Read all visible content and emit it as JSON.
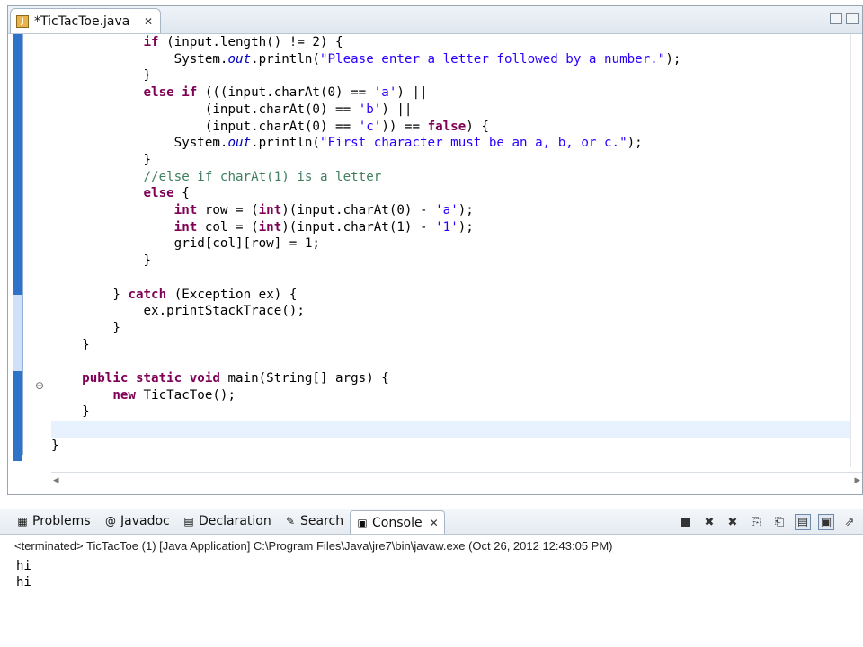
{
  "editor": {
    "tab_label": "*TicTacToe.java",
    "tab_close": "✕",
    "code_lines": [
      {
        "kind": "plain",
        "indent": "            ",
        "parts": [
          [
            "kw",
            "if"
          ],
          [
            "p",
            " (input.length() != 2) {"
          ]
        ]
      },
      {
        "kind": "plain",
        "indent": "                ",
        "parts": [
          [
            "p",
            "System."
          ],
          [
            "it",
            "out"
          ],
          [
            "p",
            ".println("
          ],
          [
            "str",
            "\"Please enter a letter followed by a number.\""
          ],
          [
            "p",
            ");"
          ]
        ]
      },
      {
        "kind": "plain",
        "indent": "            ",
        "parts": [
          [
            "p",
            "}"
          ]
        ]
      },
      {
        "kind": "plain",
        "indent": "            ",
        "parts": [
          [
            "kw",
            "else if"
          ],
          [
            "p",
            " ((("
          ],
          [
            "p",
            "input.charAt(0) == "
          ],
          [
            "str",
            "'a'"
          ],
          [
            "p",
            ") ||"
          ]
        ]
      },
      {
        "kind": "plain",
        "indent": "                    ",
        "parts": [
          [
            "p",
            "(input.charAt(0) == "
          ],
          [
            "str",
            "'b'"
          ],
          [
            "p",
            ") ||"
          ]
        ]
      },
      {
        "kind": "plain",
        "indent": "                    ",
        "parts": [
          [
            "p",
            "(input.charAt(0) == "
          ],
          [
            "str",
            "'c'"
          ],
          [
            "p",
            ")) == "
          ],
          [
            "kw",
            "false"
          ],
          [
            "p",
            ") {"
          ]
        ]
      },
      {
        "kind": "plain",
        "indent": "                ",
        "parts": [
          [
            "p",
            "System."
          ],
          [
            "it",
            "out"
          ],
          [
            "p",
            ".println("
          ],
          [
            "str",
            "\"First character must be an a, b, or c.\""
          ],
          [
            "p",
            ");"
          ]
        ]
      },
      {
        "kind": "plain",
        "indent": "            ",
        "parts": [
          [
            "p",
            "}"
          ]
        ]
      },
      {
        "kind": "plain",
        "indent": "            ",
        "parts": [
          [
            "cm",
            "//else if charAt(1) is a letter"
          ]
        ]
      },
      {
        "kind": "plain",
        "indent": "            ",
        "parts": [
          [
            "kw",
            "else"
          ],
          [
            "p",
            " {"
          ]
        ]
      },
      {
        "kind": "plain",
        "indent": "                ",
        "parts": [
          [
            "kw",
            "int"
          ],
          [
            "p",
            " row = ("
          ],
          [
            "kw",
            "int"
          ],
          [
            "p",
            ")(input.charAt(0) - "
          ],
          [
            "str",
            "'a'"
          ],
          [
            "p",
            ");"
          ]
        ]
      },
      {
        "kind": "plain",
        "indent": "                ",
        "parts": [
          [
            "kw",
            "int"
          ],
          [
            "p",
            " col = ("
          ],
          [
            "kw",
            "int"
          ],
          [
            "p",
            ")(input.charAt(1) - "
          ],
          [
            "str",
            "'1'"
          ],
          [
            "p",
            ");"
          ]
        ]
      },
      {
        "kind": "plain",
        "indent": "                ",
        "parts": [
          [
            "p",
            "grid[col][row] = 1;"
          ]
        ]
      },
      {
        "kind": "plain",
        "indent": "            ",
        "parts": [
          [
            "p",
            "}"
          ]
        ]
      },
      {
        "kind": "plain",
        "indent": "",
        "parts": []
      },
      {
        "kind": "plain",
        "indent": "        ",
        "parts": [
          [
            "p",
            "} "
          ],
          [
            "kw",
            "catch"
          ],
          [
            "p",
            " (Exception ex) {"
          ]
        ]
      },
      {
        "kind": "plain",
        "indent": "            ",
        "parts": [
          [
            "p",
            "ex.printStackTrace();"
          ]
        ]
      },
      {
        "kind": "plain",
        "indent": "        ",
        "parts": [
          [
            "p",
            "}"
          ]
        ]
      },
      {
        "kind": "plain",
        "indent": "    ",
        "parts": [
          [
            "p",
            "}"
          ]
        ]
      },
      {
        "kind": "plain",
        "indent": "",
        "parts": []
      },
      {
        "kind": "plain",
        "indent": "    ",
        "parts": [
          [
            "kw",
            "public static void"
          ],
          [
            "p",
            " main(String[] args) {"
          ]
        ]
      },
      {
        "kind": "plain",
        "indent": "        ",
        "parts": [
          [
            "kw",
            "new"
          ],
          [
            "p",
            " TicTacToe();"
          ]
        ]
      },
      {
        "kind": "plain",
        "indent": "    ",
        "parts": [
          [
            "p",
            "}"
          ]
        ]
      },
      {
        "kind": "current",
        "indent": "",
        "parts": []
      },
      {
        "kind": "plain",
        "indent": "",
        "parts": [
          [
            "p",
            "}"
          ]
        ]
      }
    ],
    "fold_glyph": "⊖"
  },
  "panel": {
    "tabs": [
      {
        "label": "Problems",
        "icon": "problems-icon",
        "glyph": "▦"
      },
      {
        "label": "Javadoc",
        "icon": "javadoc-icon",
        "glyph": "@"
      },
      {
        "label": "Declaration",
        "icon": "declaration-icon",
        "glyph": "▤"
      },
      {
        "label": "Search",
        "icon": "search-icon",
        "glyph": "✎"
      },
      {
        "label": "Console",
        "icon": "console-icon",
        "glyph": "▣",
        "active": true
      }
    ],
    "console_close": "✕",
    "toolbar": [
      {
        "name": "terminate-button-icon",
        "glyph": "■"
      },
      {
        "name": "remove-launch-icon",
        "glyph": "✖"
      },
      {
        "name": "remove-all-icon",
        "glyph": "✖"
      },
      {
        "name": "copy-icon",
        "glyph": "⎘"
      },
      {
        "name": "paste-icon",
        "glyph": "⎗"
      },
      {
        "name": "scroll-lock-icon",
        "glyph": "▤"
      },
      {
        "name": "show-console-icon",
        "glyph": "▣"
      },
      {
        "name": "open-console-icon",
        "glyph": "⇗"
      }
    ],
    "terminated_line": "<terminated> TicTacToe (1) [Java Application] C:\\Program Files\\Java\\jre7\\bin\\javaw.exe (Oct 26, 2012 12:43:05 PM)",
    "output_lines": [
      "hi",
      "hi"
    ]
  },
  "colors": {
    "keyword": "#7f0055",
    "string": "#2a00ff",
    "comment": "#3f7f5f",
    "field": "#0000c0",
    "current_line": "#e8f2fe"
  }
}
